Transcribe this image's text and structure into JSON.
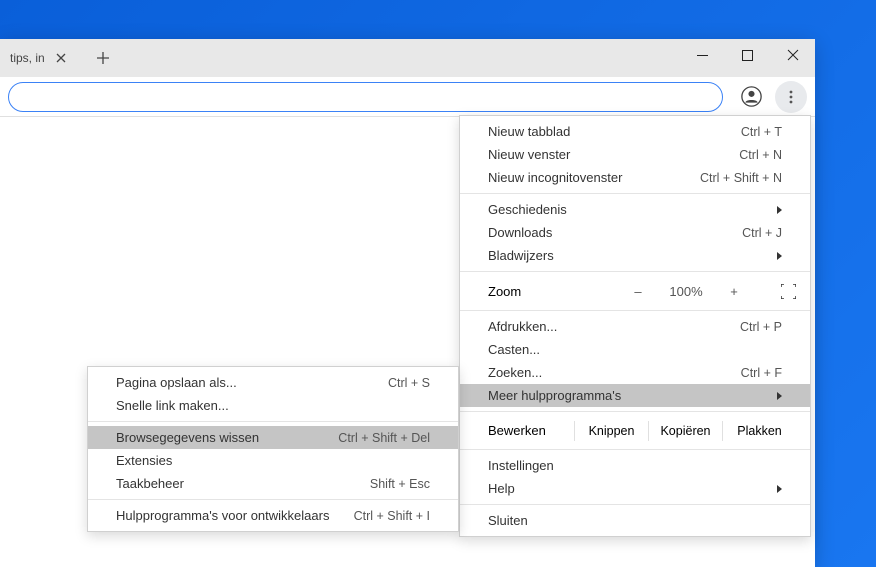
{
  "tab": {
    "title": "tips, in"
  },
  "window_controls": {
    "minimize": "minimize",
    "maximize": "maximize",
    "close": "close"
  },
  "main_menu": {
    "section1": [
      {
        "label": "Nieuw tabblad",
        "shortcut": "Ctrl + T"
      },
      {
        "label": "Nieuw venster",
        "shortcut": "Ctrl + N"
      },
      {
        "label": "Nieuw incognitovenster",
        "shortcut": "Ctrl + Shift + N"
      }
    ],
    "section2": {
      "history": {
        "label": "Geschiedenis",
        "has_submenu": true
      },
      "downloads": {
        "label": "Downloads",
        "shortcut": "Ctrl + J"
      },
      "bookmarks": {
        "label": "Bladwijzers",
        "has_submenu": true
      }
    },
    "zoom": {
      "label": "Zoom",
      "value": "100%",
      "decrease": "–",
      "increase": "+"
    },
    "section4": {
      "print": {
        "label": "Afdrukken...",
        "shortcut": "Ctrl + P"
      },
      "cast": {
        "label": "Casten..."
      },
      "find": {
        "label": "Zoeken...",
        "shortcut": "Ctrl + F"
      },
      "more_tools": {
        "label": "Meer hulpprogramma's",
        "has_submenu": true,
        "highlighted": true
      }
    },
    "edit": {
      "label": "Bewerken",
      "cut": "Knippen",
      "copy": "Kopiëren",
      "paste": "Plakken"
    },
    "section6": {
      "settings": {
        "label": "Instellingen"
      },
      "help": {
        "label": "Help",
        "has_submenu": true
      }
    },
    "section7": {
      "exit": {
        "label": "Sluiten"
      }
    }
  },
  "submenu": {
    "section1": [
      {
        "label": "Pagina opslaan als...",
        "shortcut": "Ctrl + S"
      },
      {
        "label": "Snelle link maken..."
      }
    ],
    "section2": [
      {
        "label": "Browsegegevens wissen",
        "shortcut": "Ctrl + Shift + Del",
        "highlighted": true
      },
      {
        "label": "Extensies"
      },
      {
        "label": "Taakbeheer",
        "shortcut": "Shift + Esc"
      }
    ],
    "section3": [
      {
        "label": "Hulpprogramma's voor ontwikkelaars",
        "shortcut": "Ctrl + Shift + I"
      }
    ]
  }
}
